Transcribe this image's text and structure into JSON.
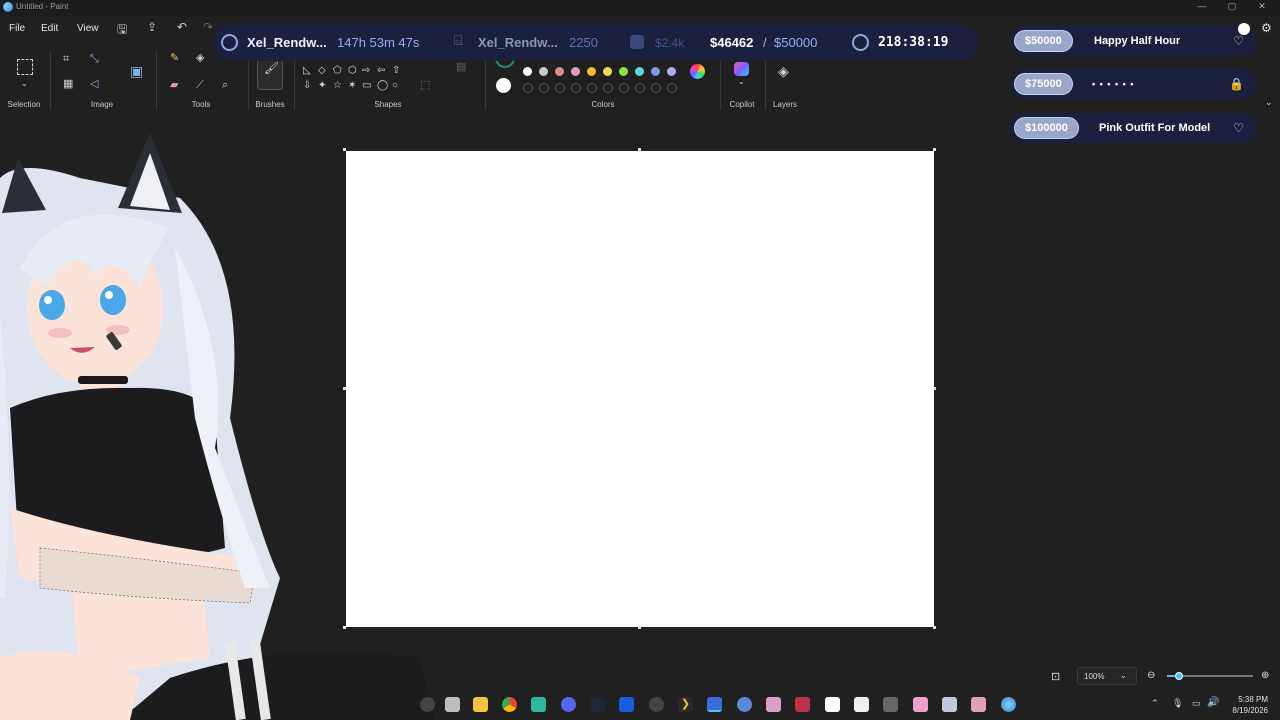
{
  "window": {
    "title": "Untitled - Paint"
  },
  "menu": [
    "File",
    "Edit",
    "View"
  ],
  "ribbon": {
    "groups": [
      "Selection",
      "Image",
      "Tools",
      "Brushes",
      "Shapes",
      "Colors",
      "Copilot",
      "Layers"
    ]
  },
  "colors": {
    "top_row": [
      "#ffffff",
      "#c8c8c8",
      "#d98c8c",
      "#e79bb8",
      "#f0c030",
      "#e8e05a",
      "#90e04a",
      "#58d8e0",
      "#7a9ae8",
      "#b8a8e8"
    ]
  },
  "stats": {
    "follower_name": "Xel_Rendw...",
    "follower_time": "147h 53m 47s",
    "sub_name": "Xel_Rendw...",
    "sub_count": "2250",
    "tips_total": "$2.4k",
    "goal_current": "$46462",
    "goal_sep": "/",
    "goal_target": "$50000",
    "timer": "218:38:19"
  },
  "goals": [
    {
      "amount": "$50000",
      "label": "Happy Half Hour",
      "icon": "heart-icon",
      "locked": false
    },
    {
      "amount": "$75000",
      "label": "• • • • • •",
      "icon": "lock-icon",
      "locked": true
    },
    {
      "amount": "$100000",
      "label": "Pink Outfit For Model",
      "icon": "heart-icon",
      "locked": false
    }
  ],
  "zoom": {
    "level": "100%"
  },
  "tray": {
    "time": "5:38 PM",
    "date": "8/19/2026"
  }
}
